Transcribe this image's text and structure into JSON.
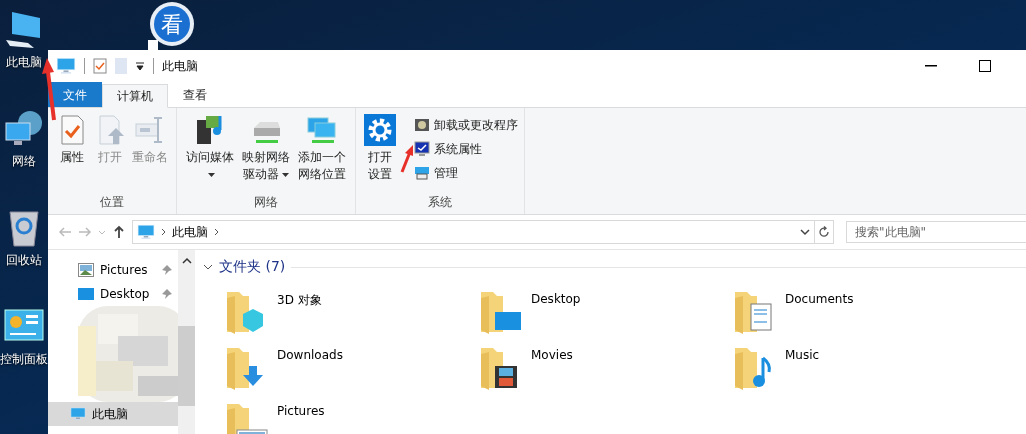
{
  "desktop_icons": [
    {
      "label": "此电脑",
      "kind": "computer"
    },
    {
      "label": "网络",
      "kind": "network"
    },
    {
      "label": "回收站",
      "kind": "recycle"
    },
    {
      "label": "控制面板",
      "kind": "control"
    }
  ],
  "shortcut": {
    "glyph": "看"
  },
  "window": {
    "title": "此电脑"
  },
  "tabs": [
    {
      "label": "文件",
      "kind": "file",
      "selected": false
    },
    {
      "label": "计算机",
      "kind": "tab",
      "selected": true
    },
    {
      "label": "查看",
      "kind": "tab",
      "selected": false
    }
  ],
  "ribbon": [
    {
      "title": "位置",
      "items": [
        {
          "label": "属性",
          "kind": "properties",
          "disabled": false,
          "dropdown": false
        },
        {
          "label": "打开",
          "kind": "open",
          "disabled": true,
          "dropdown": false
        },
        {
          "label": "重命名",
          "kind": "rename",
          "disabled": true,
          "dropdown": false
        }
      ]
    },
    {
      "title": "网络",
      "items": [
        {
          "label": "访问媒体",
          "kind": "media",
          "disabled": false,
          "dropdown": true
        },
        {
          "label": "映射网络驱动器",
          "kind": "drive",
          "disabled": false,
          "dropdown": true
        },
        {
          "label": "添加一个网络位置",
          "kind": "netloc",
          "disabled": false,
          "dropdown": false
        }
      ]
    },
    {
      "title": "系统",
      "items": [
        {
          "label": "打开设置",
          "kind": "settings",
          "disabled": false,
          "dropdown": false
        }
      ],
      "small_items": [
        {
          "label": "卸载或更改程序",
          "kind": "uninstall"
        },
        {
          "label": "系统属性",
          "kind": "sysprops"
        },
        {
          "label": "管理",
          "kind": "manage"
        }
      ]
    }
  ],
  "address": {
    "path": "此电脑"
  },
  "search": {
    "placeholder": "搜索\"此电脑\""
  },
  "nav": [
    {
      "kind": "pictures",
      "label": "Pictures",
      "pinned": true,
      "selected": false
    },
    {
      "kind": "desktop",
      "label": "Desktop",
      "pinned": true,
      "selected": false
    },
    {
      "kind": "redacted"
    },
    {
      "kind": "computer",
      "label": "此电脑",
      "pinned": false,
      "selected": true
    }
  ],
  "section": {
    "title": "文件夹 (7)",
    "expanded": true
  },
  "folders": [
    {
      "name": "3D 对象",
      "kind": "objects"
    },
    {
      "name": "Desktop",
      "kind": "desktop"
    },
    {
      "name": "Documents",
      "kind": "documents"
    },
    {
      "name": "Downloads",
      "kind": "downloads"
    },
    {
      "name": "Movies",
      "kind": "movies"
    },
    {
      "name": "Music",
      "kind": "music"
    },
    {
      "name": "Pictures",
      "kind": "pictures"
    }
  ]
}
